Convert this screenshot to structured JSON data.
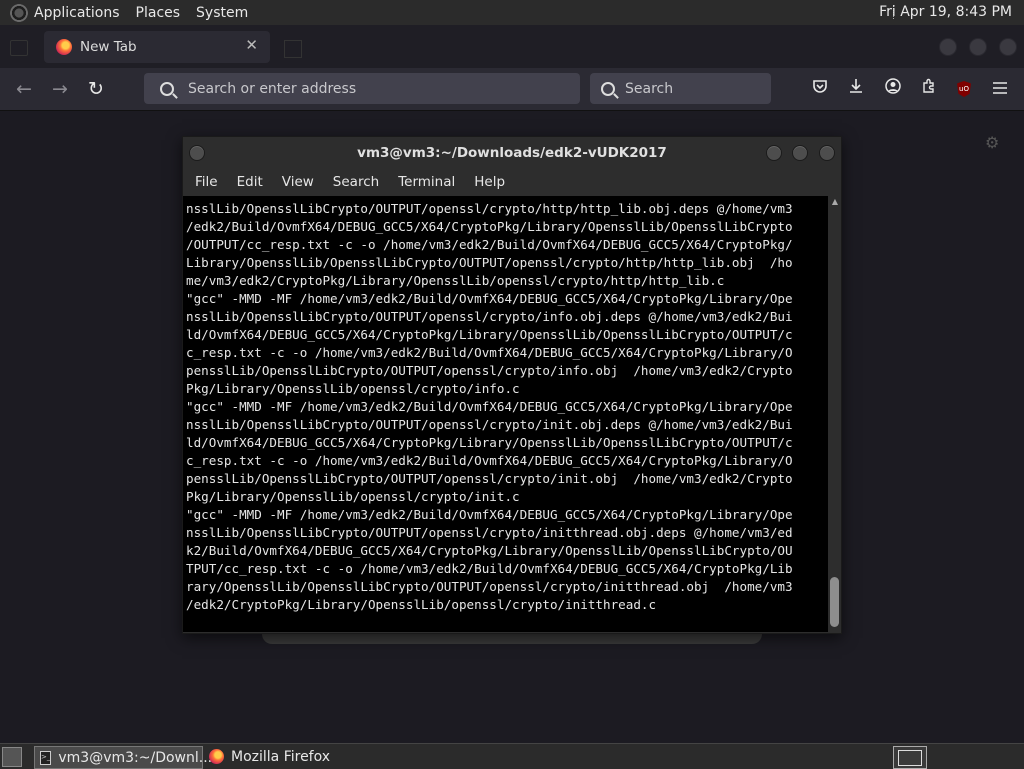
{
  "top_panel": {
    "menus": [
      "Applications",
      "Places",
      "System"
    ],
    "clock": "Fri Apr 19,  8:43 PM"
  },
  "firefox": {
    "tab_title": "New Tab",
    "tab_close": "✕",
    "url_placeholder": "Search or enter address",
    "search_placeholder": "Search",
    "ublock_label": "uO"
  },
  "terminal": {
    "title": "vm3@vm3:~/Downloads/edk2-vUDK2017",
    "menu": [
      "File",
      "Edit",
      "View",
      "Search",
      "Terminal",
      "Help"
    ],
    "lines": [
      "nsslLib/OpensslLibCrypto/OUTPUT/openssl/crypto/http/http_lib.obj.deps @/home/vm3",
      "/edk2/Build/OvmfX64/DEBUG_GCC5/X64/CryptoPkg/Library/OpensslLib/OpensslLibCrypto",
      "/OUTPUT/cc_resp.txt -c -o /home/vm3/edk2/Build/OvmfX64/DEBUG_GCC5/X64/CryptoPkg/",
      "Library/OpensslLib/OpensslLibCrypto/OUTPUT/openssl/crypto/http/http_lib.obj  /ho",
      "me/vm3/edk2/CryptoPkg/Library/OpensslLib/openssl/crypto/http/http_lib.c",
      "\"gcc\" -MMD -MF /home/vm3/edk2/Build/OvmfX64/DEBUG_GCC5/X64/CryptoPkg/Library/Ope",
      "nsslLib/OpensslLibCrypto/OUTPUT/openssl/crypto/info.obj.deps @/home/vm3/edk2/Bui",
      "ld/OvmfX64/DEBUG_GCC5/X64/CryptoPkg/Library/OpensslLib/OpensslLibCrypto/OUTPUT/c",
      "c_resp.txt -c -o /home/vm3/edk2/Build/OvmfX64/DEBUG_GCC5/X64/CryptoPkg/Library/O",
      "pensslLib/OpensslLibCrypto/OUTPUT/openssl/crypto/info.obj  /home/vm3/edk2/Crypto",
      "Pkg/Library/OpensslLib/openssl/crypto/info.c",
      "\"gcc\" -MMD -MF /home/vm3/edk2/Build/OvmfX64/DEBUG_GCC5/X64/CryptoPkg/Library/Ope",
      "nsslLib/OpensslLibCrypto/OUTPUT/openssl/crypto/init.obj.deps @/home/vm3/edk2/Bui",
      "ld/OvmfX64/DEBUG_GCC5/X64/CryptoPkg/Library/OpensslLib/OpensslLibCrypto/OUTPUT/c",
      "c_resp.txt -c -o /home/vm3/edk2/Build/OvmfX64/DEBUG_GCC5/X64/CryptoPkg/Library/O",
      "pensslLib/OpensslLibCrypto/OUTPUT/openssl/crypto/init.obj  /home/vm3/edk2/Crypto",
      "Pkg/Library/OpensslLib/openssl/crypto/init.c",
      "\"gcc\" -MMD -MF /home/vm3/edk2/Build/OvmfX64/DEBUG_GCC5/X64/CryptoPkg/Library/Ope",
      "nsslLib/OpensslLibCrypto/OUTPUT/openssl/crypto/initthread.obj.deps @/home/vm3/ed",
      "k2/Build/OvmfX64/DEBUG_GCC5/X64/CryptoPkg/Library/OpensslLib/OpensslLibCrypto/OU",
      "TPUT/cc_resp.txt -c -o /home/vm3/edk2/Build/OvmfX64/DEBUG_GCC5/X64/CryptoPkg/Lib",
      "rary/OpensslLib/OpensslLibCrypto/OUTPUT/openssl/crypto/initthread.obj  /home/vm3",
      "/edk2/CryptoPkg/Library/OpensslLib/openssl/crypto/initthread.c"
    ]
  },
  "taskbar": {
    "items": [
      {
        "label": "vm3@vm3:~/Downl...",
        "icon": "terminal-icon",
        "active": true
      },
      {
        "label": "Mozilla Firefox",
        "icon": "firefox-icon",
        "active": false
      }
    ]
  },
  "icons": {
    "back": "←",
    "forward": "→",
    "reload": "↻",
    "settings": "⚙"
  },
  "colors": {
    "desktop_bg": "#1c1b22",
    "terminal_bg": "#000000",
    "terminal_fg": "#e6e6e6",
    "panel_bg": "#2b2b2b"
  }
}
